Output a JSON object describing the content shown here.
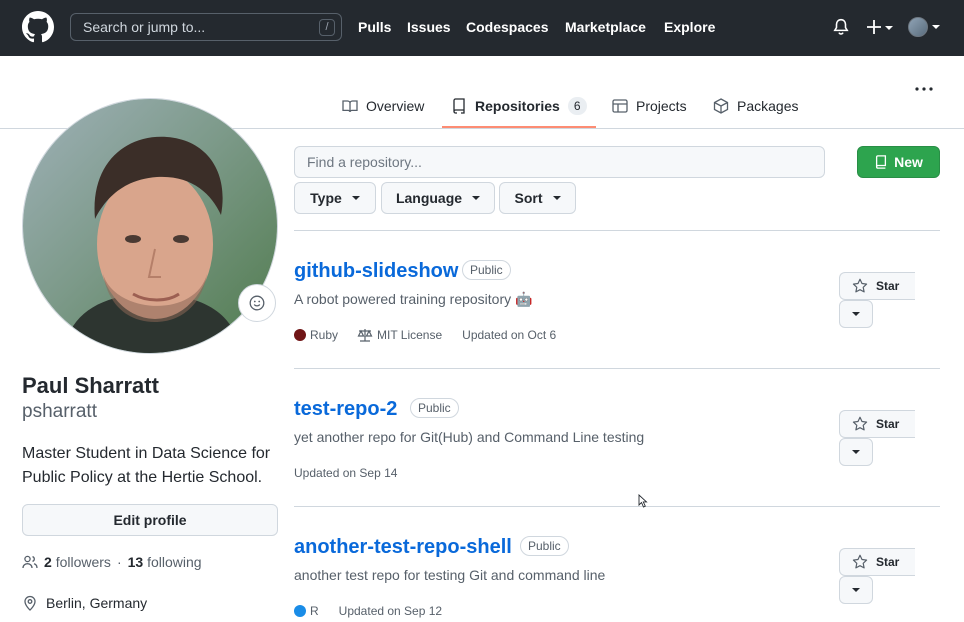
{
  "header": {
    "search_placeholder": "Search or jump to...",
    "search_shortcut": "/",
    "nav": [
      "Pulls",
      "Issues",
      "Codespaces",
      "Marketplace",
      "Explore"
    ],
    "plus_label": "+"
  },
  "tabs": [
    {
      "label": "Overview",
      "icon": "book-icon"
    },
    {
      "label": "Repositories",
      "icon": "repo-icon",
      "count": "6",
      "selected": true
    },
    {
      "label": "Projects",
      "icon": "table-icon"
    },
    {
      "label": "Packages",
      "icon": "package-icon"
    }
  ],
  "profile": {
    "name": "Paul Sharratt",
    "login": "psharratt",
    "bio": "Master Student in Data Science for Public Policy at the Hertie School.",
    "edit_label": "Edit profile",
    "followers": "2",
    "followers_label": "followers",
    "dot": "·",
    "following": "13",
    "following_label": "following",
    "location": "Berlin, Germany"
  },
  "filters": {
    "find_placeholder": "Find a repository...",
    "type_label": "Type",
    "language_label": "Language",
    "sort_label": "Sort",
    "new_label": "New"
  },
  "repos": [
    {
      "name": "github-slideshow",
      "visibility": "Public",
      "description": "A robot powered training repository 🤖",
      "language": "Ruby",
      "language_color": "#701516",
      "license": "MIT License",
      "updated": "Updated on Oct 6",
      "star_label": "Star"
    },
    {
      "name": "test-repo-2",
      "visibility": "Public",
      "description": "yet another repo for Git(Hub) and Command Line testing",
      "updated": "Updated on Sep 14",
      "star_label": "Star"
    },
    {
      "name": "another-test-repo-shell",
      "visibility": "Public",
      "description": "another test repo for testing Git and command line",
      "language": "R",
      "language_color": "#198CE7",
      "updated": "Updated on Sep 12",
      "star_label": "Star"
    }
  ],
  "colors": {
    "header_bg": "#24292f",
    "link": "#0969da",
    "new_button": "#2da44e",
    "tab_underline": "#fd8c73"
  }
}
